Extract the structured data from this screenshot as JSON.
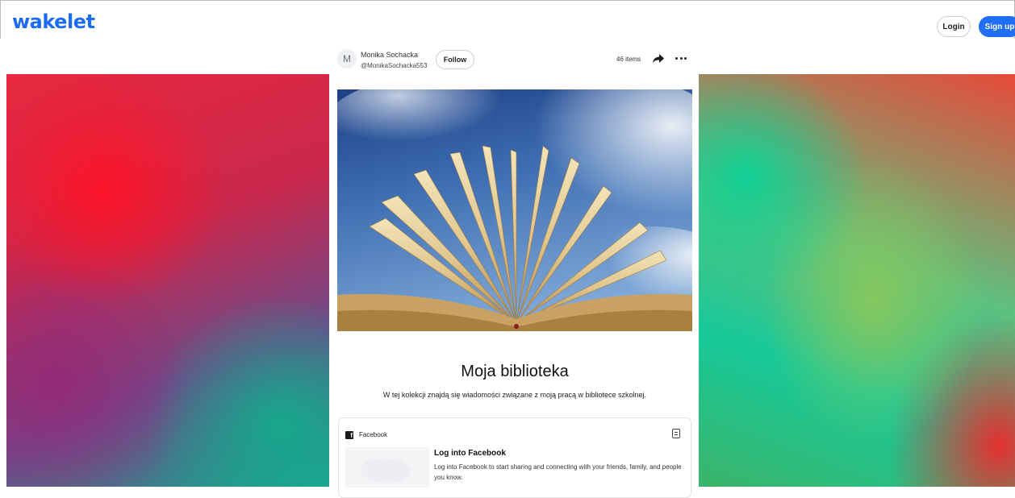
{
  "header": {
    "logo_text": "wakelet",
    "login_label": "Login",
    "signup_label": "Sign up"
  },
  "collection": {
    "author": {
      "avatar_initial": "M",
      "name": "Monika Sochacka",
      "handle": "@MonikaSochacka553"
    },
    "follow_label": "Follow",
    "item_count": "46 items",
    "share_icon": "share-arrow-icon",
    "more_icon": "more-horizontal-icon",
    "title": "Moja biblioteka",
    "description": "W tej kolekcji znajdą się wiadomości związane z moją pracą w bibliotece szkolnej."
  },
  "items": [
    {
      "source": "Facebook",
      "source_icon": "facebook-icon",
      "title": "Log into Facebook",
      "description": "Log into Facebook to start sharing and connecting with your friends, family, and people you know."
    }
  ],
  "colors": {
    "brand": "#1b6cf2",
    "signup_bg": "#1f6ef5"
  }
}
